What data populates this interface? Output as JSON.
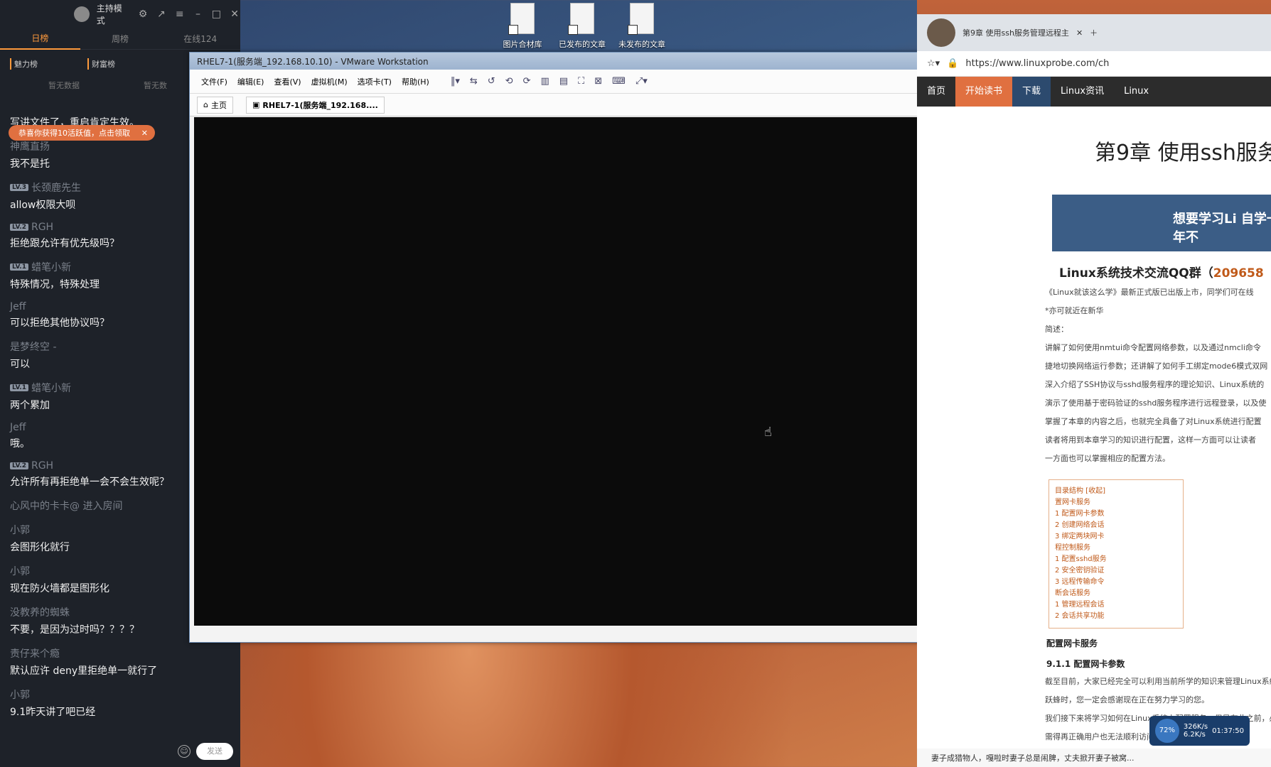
{
  "desktop": {
    "icons": [
      {
        "label": "图片合材库",
        "icon": "folder-icon"
      },
      {
        "label": "已发布的文章",
        "icon": "folder-icon"
      },
      {
        "label": "未发布的文章",
        "icon": "folder-icon"
      }
    ]
  },
  "chat": {
    "mode": "主持模式",
    "tabs": [
      "日榜",
      "周榜",
      "在线124"
    ],
    "boards": [
      "魅力榜",
      "财富榜"
    ],
    "nodata": [
      "暂无数据",
      "暂无数"
    ],
    "toast": "恭喜你获得10活跃值，点击领取",
    "messages": [
      {
        "user": "",
        "text": "写讲文件了，重启肯定生效。"
      },
      {
        "user": "神鹰直扬",
        "text": "我不是托"
      },
      {
        "user": "长颈鹿先生",
        "lv": "LV.3",
        "text": "allow权限大呗"
      },
      {
        "user": "RGH",
        "lv": "LV.2",
        "text": "拒绝跟允许有优先级吗？"
      },
      {
        "user": "蜡笔小新",
        "lv": "LV.1",
        "text": "特殊情况，特殊处理"
      },
      {
        "user": "Jeff",
        "text": "可以拒绝其他协议吗？"
      },
      {
        "user": "是梦终空 -",
        "text": "可以"
      },
      {
        "user": "蜡笔小新",
        "lv": "LV.1",
        "text": "两个累加"
      },
      {
        "user": "Jeff",
        "text": "哦。"
      },
      {
        "user": "RGH",
        "lv": "LV.2",
        "text": "允许所有再拒绝单一会不会生效呢？"
      },
      {
        "system": "心风中的卡卡@ 进入房间"
      },
      {
        "user": "小郭",
        "text": "会图形化就行"
      },
      {
        "user": "小郭",
        "text": "现在防火墙都是图形化"
      },
      {
        "user": "没教养的蜘蛛",
        "text": "不要，是因为过时吗？？？？"
      },
      {
        "user": "责仔来个瘾",
        "text": "默认应许 deny里拒绝单一就行了"
      },
      {
        "user": "小郭",
        "text": "9.1昨天讲了吧已经"
      }
    ],
    "send_label": "发送"
  },
  "vmware": {
    "title": "RHEL7-1(服务端_192.168.10.10) - VMware Workstation",
    "menu": [
      "文件(F)",
      "编辑(E)",
      "查看(V)",
      "虚拟机(M)",
      "选项卡(T)",
      "帮助(H)"
    ],
    "tabs": [
      "主页",
      "RHEL7-1(服务端_192.168...."
    ]
  },
  "browser": {
    "tab_title": "第9章 使用ssh服务管理远程主",
    "url": "https://www.linuxprobe.com/ch",
    "nav": [
      "首页",
      "开始读书",
      "下载",
      "Linux资讯",
      "Linux"
    ],
    "article_title": "第9章 使用ssh服务",
    "banner": "想要学习Li 自学一年不",
    "qq_label": "Linux系统技术交流QQ群（",
    "qq_number": "209658",
    "paras": [
      "《Linux就该这么学》最新正式版已出版上市，同学们可在线",
      "*亦可就近在新华",
      "简述：",
      "讲解了如何使用nmtui命令配置网络参数，以及通过nmcli命令",
      "捷地切换网络运行参数；还讲解了如何手工绑定mode6模式双网",
      "深入介绍了SSH协议与sshd服务程序的理论知识、Linux系统的",
      "演示了使用基于密码验证的sshd服务程序进行远程登录，以及使",
      "掌握了本章的内容之后，也就完全具备了对Linux系统进行配置",
      "读者将用到本章学习的知识进行配置，这样一方面可以让读者",
      "一方面也可以掌握相应的配置方法。"
    ],
    "toc_title": "目录结构 [收起]",
    "toc": [
      "置网卡服务",
      "1 配置网卡参数",
      "2 创建网络会话",
      "3 绑定两块网卡",
      "程控制服务",
      "1 配置sshd服务",
      "2 安全密钥验证",
      "3 远程传输命令",
      "断会话服务",
      "1 管理远程会话",
      "2 会话共享功能"
    ],
    "section": "配置网卡服务",
    "subsection": "9.1.1 配置网卡参数",
    "body": [
      "截至目前，大家已经完全可以利用当前所学的知识来管理Linux系统",
      "跃蜂时，您一定会感谢现在正在努力学习的您。",
      "我们接下来将学习如何在Linux系统上配置服务。但是在此之前，必",
      "需得再正确用户也无法顺利访问，所"
    ],
    "footer": [
      "妻子成猎物人，嘎啦时妻子总是闹脾，丈夫掀开妻子被窝..."
    ],
    "speed": {
      "cpu": "72%",
      "up": "326K/s",
      "down": "6.2K/s",
      "time": "01:37:50"
    }
  }
}
